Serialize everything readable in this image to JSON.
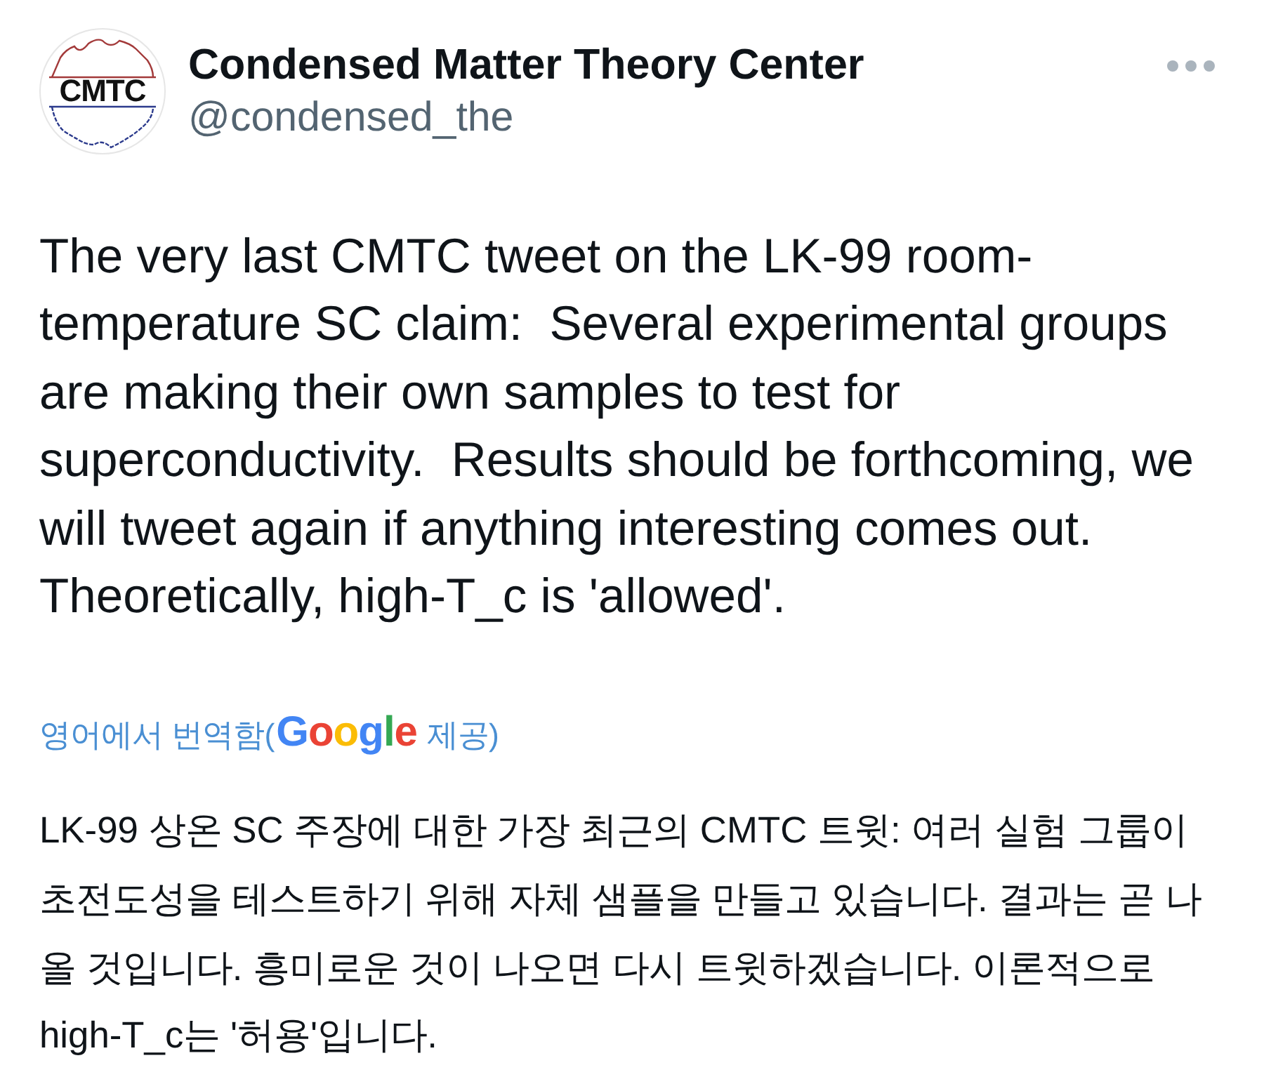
{
  "author": {
    "avatar_text": "CMTC",
    "name": "Condensed Matter Theory Center",
    "handle": "@condensed_the"
  },
  "tweet": {
    "lines": [
      "The very last CMTC tweet on the LK-99 room-",
      "temperature SC claim:  Several experimental groups",
      "are making their own samples to test for",
      "superconductivity.  Results should be forthcoming, we",
      "will tweet again if anything interesting comes out.",
      "Theoretically, high-T_c is 'allowed'."
    ]
  },
  "translation": {
    "label": "영어에서 번역함(",
    "logo": "Google",
    "suffix": "제공)"
  },
  "translated": {
    "lines": [
      "LK-99 상온 SC 주장에 대한 가장 최근의 CMTC 트윗: 여러 실험 그룹이",
      "초전도성을 테스트하기 위해 자체 샘플을 만들고 있습니다. 결과는 곧 나",
      "올 것입니다. 흥미로운 것이 나오면 다시 트윗하겠습니다. 이론적으로",
      "high-T_c는 '허용'입니다."
    ]
  }
}
